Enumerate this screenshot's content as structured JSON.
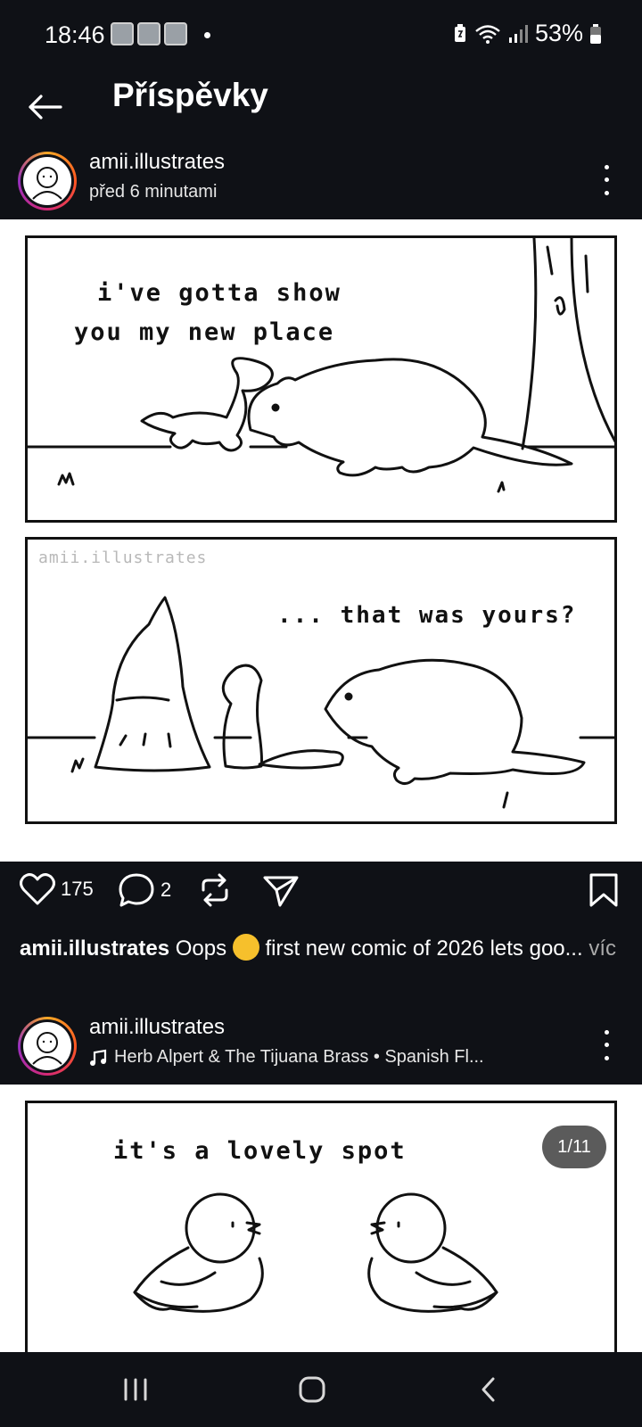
{
  "status_bar": {
    "time": "18:46",
    "battery": "53%",
    "notification_icons": [
      "app-notification-icon",
      "app-notification-icon",
      "app-notification-icon"
    ]
  },
  "header": {
    "title": "Příspěvky",
    "back_icon": "arrow-left-icon"
  },
  "posts": [
    {
      "username": "amii.illustrates",
      "subtitle": "před 6 minutami",
      "comic": {
        "panel1_text_line1": "i've gotta show",
        "panel1_text_line2": "you my new place",
        "watermark": "amii.illustrates",
        "panel2_text": "... that was yours?"
      },
      "likes": "175",
      "comments": "2",
      "caption": {
        "username": "amii.illustrates",
        "text_before_emoji": "Oops",
        "text_after_emoji": "first new comic of 2026 lets goo...",
        "more": "víc"
      }
    },
    {
      "username": "amii.illustrates",
      "music": "Herb Alpert & The Tijuana Brass • Spanish Fl...",
      "comic": {
        "panel_text": "it's a lovely spot"
      },
      "counter": "1/11"
    }
  ],
  "nav": {
    "recents_icon": "recents-icon",
    "home_icon": "home-icon",
    "back_icon": "nav-back-icon"
  }
}
